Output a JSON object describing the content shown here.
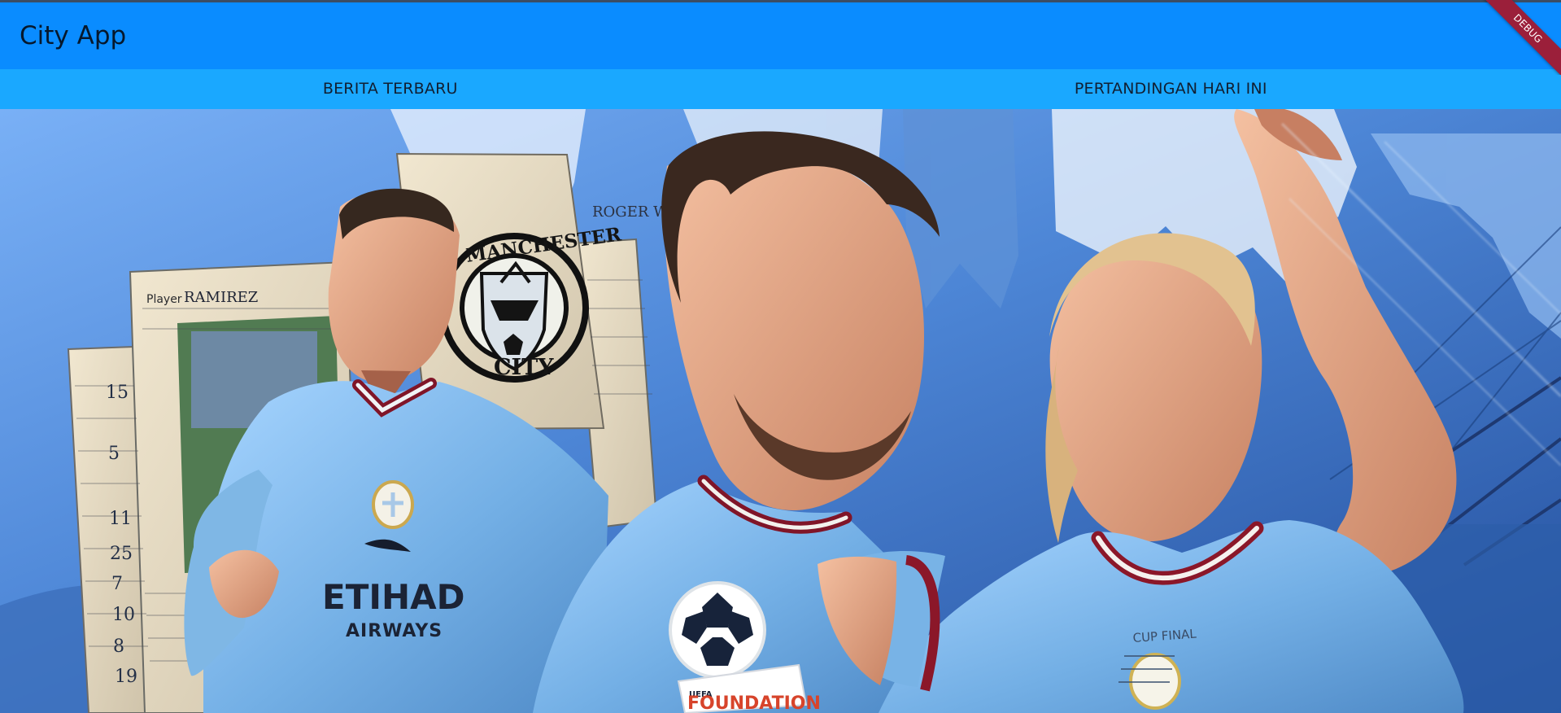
{
  "appbar": {
    "title": "City App",
    "debug_label": "DEBUG"
  },
  "tabs": [
    {
      "label": "BERITA TERBARU"
    },
    {
      "label": "PERTANDINGAN HARI INI"
    }
  ],
  "hero": {
    "crest_top": "MANCHESTER",
    "crest_bottom": "CITY",
    "sponsor_main": "ETIHAD",
    "sponsor_sub": "AIRWAYS",
    "foundation": "FOUNDATION",
    "uefa": "UEFA",
    "final_text": "CUP FINAL",
    "name_block": "ROGER W",
    "card_numbers": [
      "15",
      "5",
      "11",
      "25",
      "7",
      "10",
      "8",
      "19"
    ],
    "player_card_label": "Player",
    "player_card_name": "RAMIREZ",
    "colors": {
      "sky": "#76aaf2",
      "shirt": "#7ab6ec",
      "navy": "#11213d",
      "maroon": "#8f1d2f"
    }
  }
}
